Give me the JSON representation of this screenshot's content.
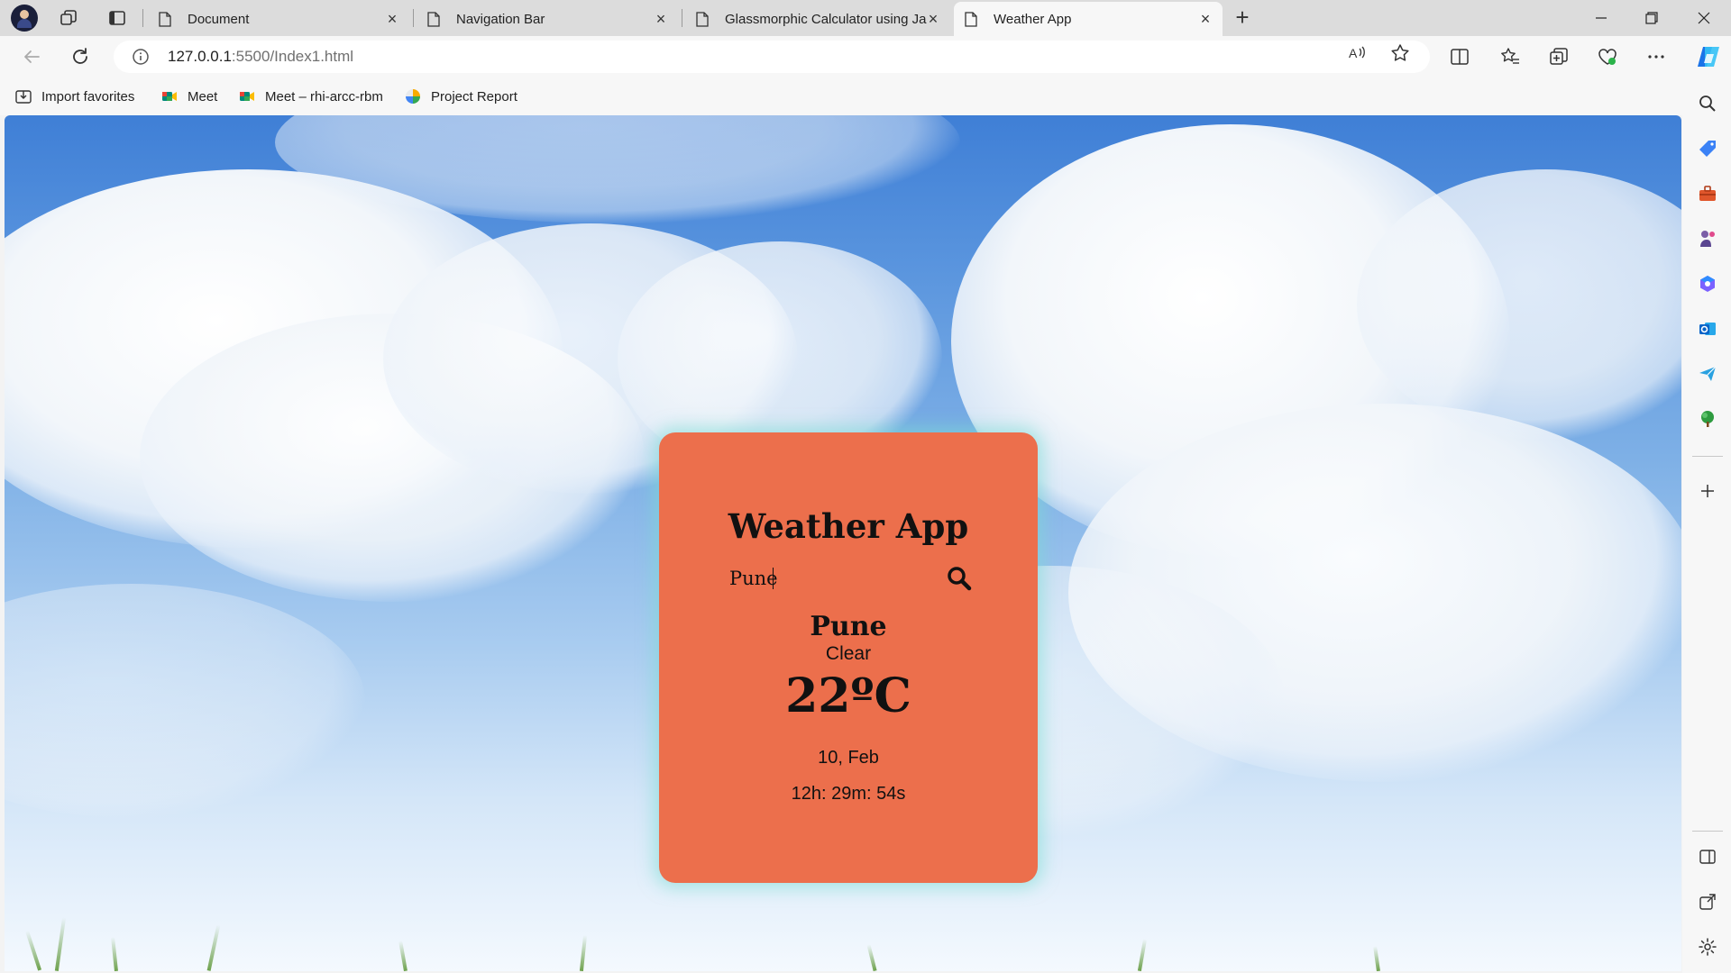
{
  "browser": {
    "tabs": [
      {
        "title": "Document",
        "active": false
      },
      {
        "title": "Navigation Bar",
        "active": false
      },
      {
        "title": "Glassmorphic Calculator using Ja",
        "active": false
      },
      {
        "title": "Weather App",
        "active": true
      }
    ],
    "address": {
      "host": "127.0.0.1",
      "rest": ":5500/Index1.html"
    },
    "favorites": [
      {
        "label": "Import favorites",
        "icon": "import-favorites-icon"
      },
      {
        "label": "Meet",
        "icon": "google-meet-icon"
      },
      {
        "label": "Meet – rhi-arcc-rbm",
        "icon": "google-meet-icon"
      },
      {
        "label": "Project Report",
        "icon": "project-report-icon"
      }
    ]
  },
  "weather": {
    "title": "Weather App",
    "search_value": "Pune",
    "city": "Pune",
    "condition": "Clear",
    "temperature": "22ºC",
    "date": "10, Feb",
    "time": "12h: 29m: 54s"
  },
  "colors": {
    "card_background": "#ec6f4c",
    "card_glow": "#78dcd2",
    "sky_top": "#3f7fd6",
    "sky_bottom": "#f4f9fe"
  }
}
